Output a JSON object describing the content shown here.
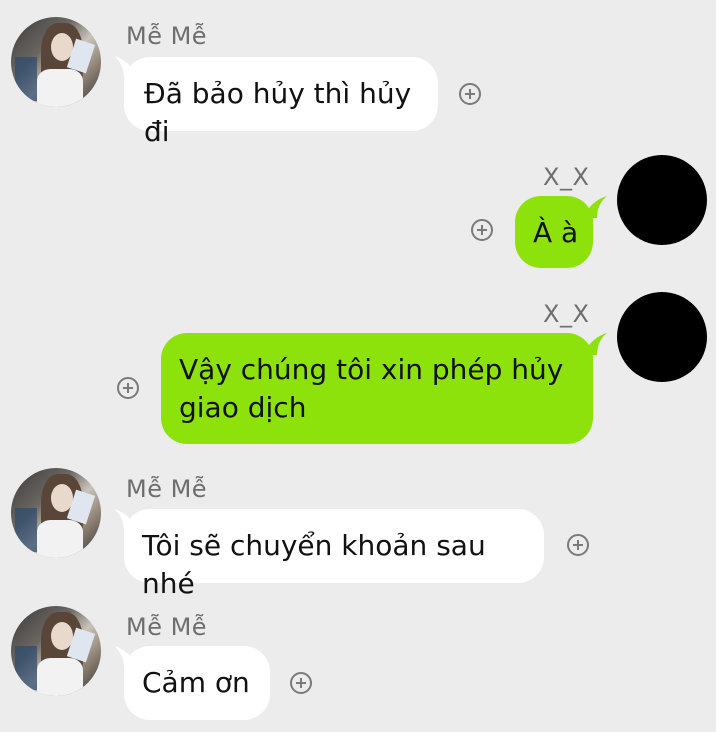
{
  "messages": [
    {
      "sender": "Mễ Mễ",
      "text": "Đã bảo hủy thì hủy đi",
      "direction": "incoming"
    },
    {
      "sender": "X_X",
      "text": "À à",
      "direction": "outgoing"
    },
    {
      "sender": "X_X",
      "text": "Vậy chúng tôi xin phép hủy giao dịch",
      "direction": "outgoing"
    },
    {
      "sender": "Mễ Mễ",
      "text": "Tôi sẽ chuyển khoản sau nhé",
      "direction": "incoming"
    },
    {
      "sender": "Mễ Mễ",
      "text": "Cảm ơn",
      "direction": "incoming"
    }
  ],
  "colors": {
    "background": "#ececec",
    "incoming_bubble": "#ffffff",
    "outgoing_bubble": "#8de20c",
    "name_text": "#6e6e6e"
  },
  "icons": {
    "reaction": "add-reaction-icon"
  }
}
